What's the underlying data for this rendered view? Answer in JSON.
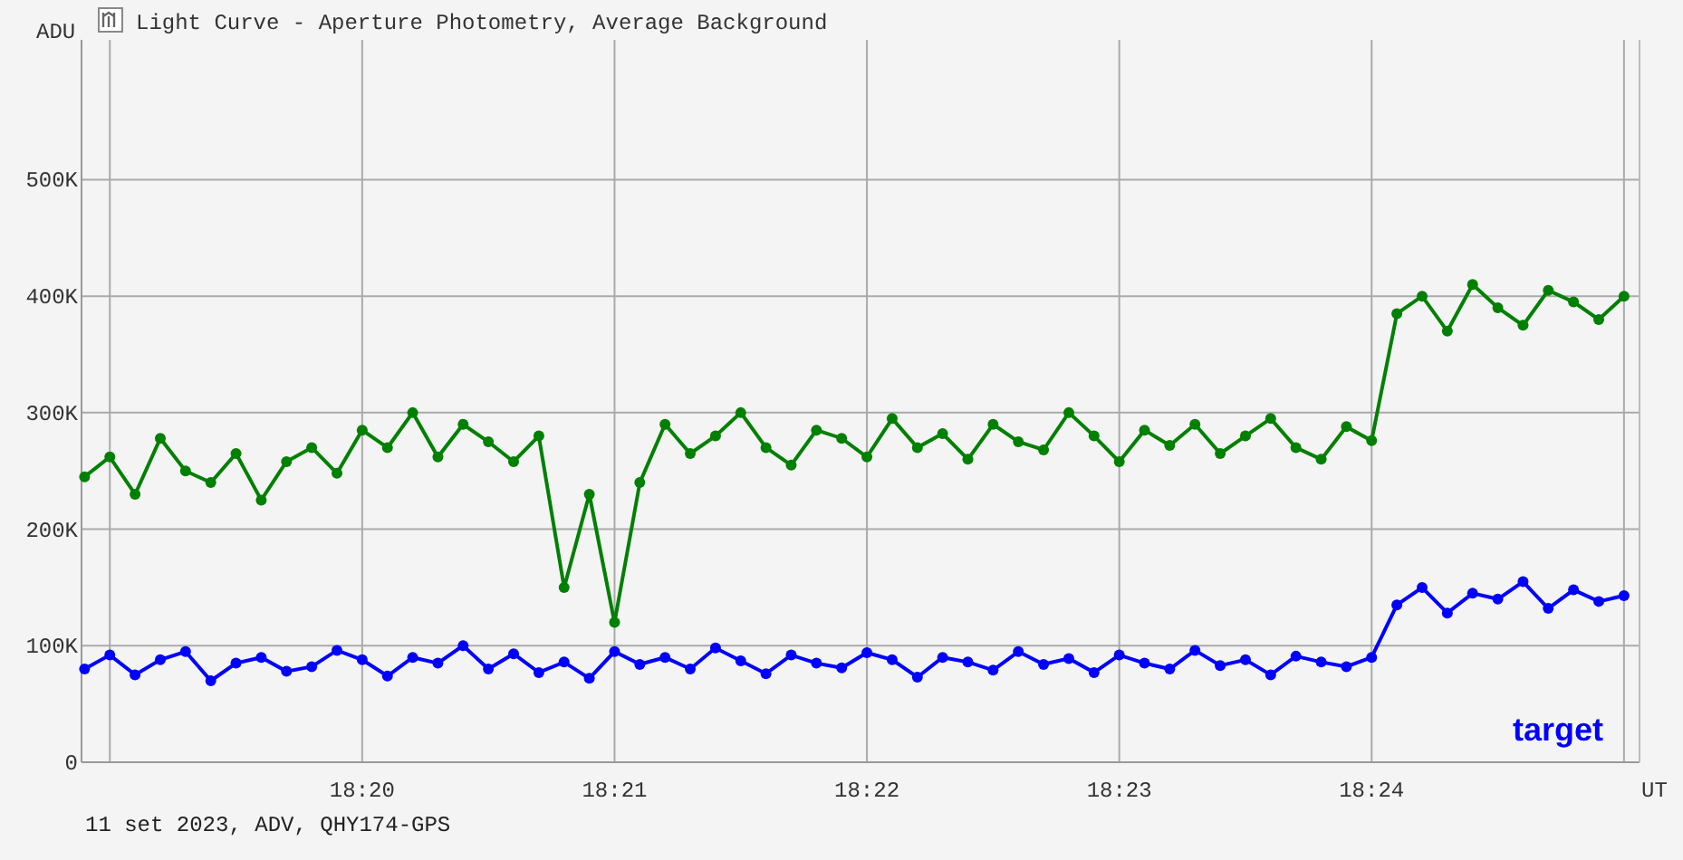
{
  "chart": {
    "chart_data": {
      "type": "line",
      "title": "Light Curve - Aperture Photometry, Average Background",
      "ylabel": "ADU",
      "xlabel": "UT",
      "ylim": [
        0,
        620000
      ],
      "grid": true,
      "yticks": [
        {
          "value": 0,
          "label": "0"
        },
        {
          "value": 100000,
          "label": "100K"
        },
        {
          "value": 200000,
          "label": "200K"
        },
        {
          "value": 300000,
          "label": "300K"
        },
        {
          "value": 400000,
          "label": "400K"
        },
        {
          "value": 500000,
          "label": "500K"
        }
      ],
      "categories": [
        null,
        null,
        null,
        null,
        null,
        null,
        null,
        null,
        null,
        null,
        null,
        "18:20",
        null,
        null,
        null,
        null,
        null,
        null,
        null,
        null,
        null,
        "18:21",
        null,
        null,
        null,
        null,
        null,
        null,
        null,
        null,
        null,
        "18:22",
        null,
        null,
        null,
        null,
        null,
        null,
        null,
        null,
        null,
        "18:23",
        null,
        null,
        null,
        null,
        null,
        null,
        null,
        null,
        null,
        "18:24",
        null,
        null,
        null,
        null,
        null,
        null,
        null,
        null,
        null,
        null
      ],
      "series": [
        {
          "color": "#008000",
          "marker": "o",
          "values": [
            245000,
            262000,
            230000,
            278000,
            250000,
            240000,
            265000,
            225000,
            258000,
            270000,
            248000,
            285000,
            270000,
            300000,
            262000,
            290000,
            275000,
            258000,
            280000,
            150000,
            230000,
            120000,
            240000,
            290000,
            265000,
            280000,
            300000,
            270000,
            255000,
            285000,
            278000,
            262000,
            295000,
            270000,
            282000,
            260000,
            290000,
            275000,
            268000,
            300000,
            280000,
            258000,
            285000,
            272000,
            290000,
            265000,
            280000,
            295000,
            270000,
            260000,
            288000,
            276000,
            385000,
            400000,
            370000,
            410000,
            390000,
            375000,
            405000,
            395000,
            380000,
            400000
          ]
        },
        {
          "color": "#0000ff",
          "marker": "o",
          "values": [
            80000,
            92000,
            75000,
            88000,
            95000,
            70000,
            85000,
            90000,
            78000,
            82000,
            96000,
            88000,
            74000,
            90000,
            85000,
            100000,
            80000,
            93000,
            77000,
            86000,
            72000,
            95000,
            84000,
            90000,
            80000,
            98000,
            87000,
            76000,
            92000,
            85000,
            81000,
            94000,
            88000,
            73000,
            90000,
            86000,
            79000,
            95000,
            84000,
            89000,
            77000,
            92000,
            85000,
            80000,
            96000,
            83000,
            88000,
            75000,
            91000,
            86000,
            82000,
            90000,
            135000,
            150000,
            128000,
            145000,
            140000,
            155000,
            132000,
            148000,
            138000,
            143000
          ]
        }
      ],
      "annotations": [
        "target"
      ]
    }
  },
  "footer": "11 set 2023, ADV, QHY174-GPS"
}
